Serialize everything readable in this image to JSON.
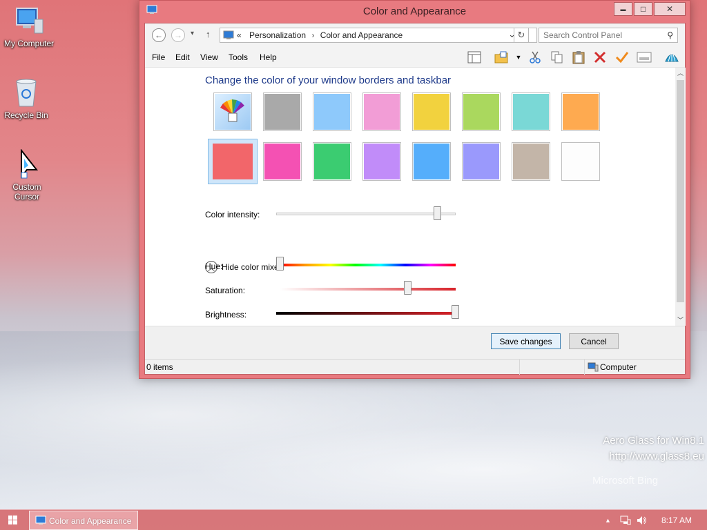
{
  "desktop": {
    "icons": [
      {
        "label": "My Computer"
      },
      {
        "label": "Recycle Bin"
      },
      {
        "label": "Custom Cursor"
      }
    ],
    "watermark_line1": "Aero Glass for Win8.1",
    "watermark_line2": "http://www.glass8.eu",
    "bing": "Microsoft Bing"
  },
  "window": {
    "title": "Color and Appearance",
    "minimize_glyph": "▬",
    "maximize_glyph": "□",
    "close_glyph": "✕"
  },
  "address": {
    "back_glyph": "←",
    "forward_glyph": "→",
    "recent_glyph": "▾",
    "up_glyph": "↑",
    "prefix": "«",
    "crumb1": "Personalization",
    "separator": "›",
    "crumb2": "Color and Appearance",
    "dropdown_glyph": "⌄",
    "refresh_glyph": "↻",
    "search_placeholder": "Search Control Panel",
    "search_glyph": "⚲"
  },
  "menu": {
    "file": "File",
    "edit": "Edit",
    "view": "View",
    "tools": "Tools",
    "help": "Help"
  },
  "toolbar_icons": [
    "pane-icon",
    "folder-options-icon",
    "dropdown-icon",
    "cut-icon",
    "copy-icon",
    "paste-icon",
    "delete-icon",
    "checkmark-icon",
    "properties-icon",
    "seashell-icon"
  ],
  "main": {
    "heading": "Change the color of your window borders and taskbar",
    "swatches_row1": [
      "#colorpicker",
      "#a9a9a9",
      "#8ec9fb",
      "#f29dd6",
      "#f2d23e",
      "#aad85e",
      "#7ad8d6",
      "#feaa50"
    ],
    "swatches_row2": [
      "#f2666a",
      "#f451b3",
      "#3bcc71",
      "#c18cf9",
      "#55aefb",
      "#9a99fc",
      "#c3b5a8",
      "#fdfdfd"
    ],
    "selected_swatch": "#f2666a",
    "intensity_label": "Color intensity:",
    "intensity_value": 0.9,
    "mixer_toggle": "Hide color mixer",
    "hue_label": "Hue:",
    "hue_value": 0.0,
    "saturation_label": "Saturation:",
    "saturation_value": 0.73,
    "brightness_label": "Brightness:",
    "brightness_value": 1.0,
    "accent_red": "#d8232a"
  },
  "footer": {
    "save": "Save changes",
    "cancel": "Cancel"
  },
  "status": {
    "items": "0 items",
    "location": "Computer"
  },
  "taskbar": {
    "task_label": "Color and Appearance",
    "time": "8:17 AM",
    "tray_up": "▲"
  }
}
